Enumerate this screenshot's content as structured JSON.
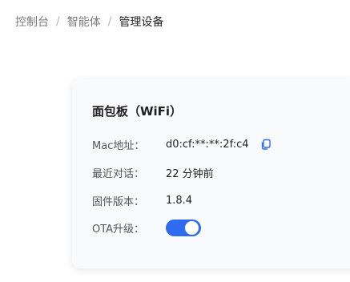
{
  "breadcrumb": {
    "items": [
      "控制台",
      "智能体",
      "管理设备"
    ],
    "separator": "/"
  },
  "device": {
    "title": "面包板（WiFi）",
    "mac_label": "Mac地址：",
    "mac_value": "d0:cf:**:**:2f:c4",
    "last_chat_label": "最近对话：",
    "last_chat_value": "22 分钟前",
    "firmware_label": "固件版本：",
    "firmware_value": "1.8.4",
    "ota_label": "OTA升级：",
    "ota_enabled": true
  },
  "icons": {
    "copy": "copy-icon"
  },
  "colors": {
    "accent": "#2e6bf1",
    "card_background": "#f9fafb"
  }
}
